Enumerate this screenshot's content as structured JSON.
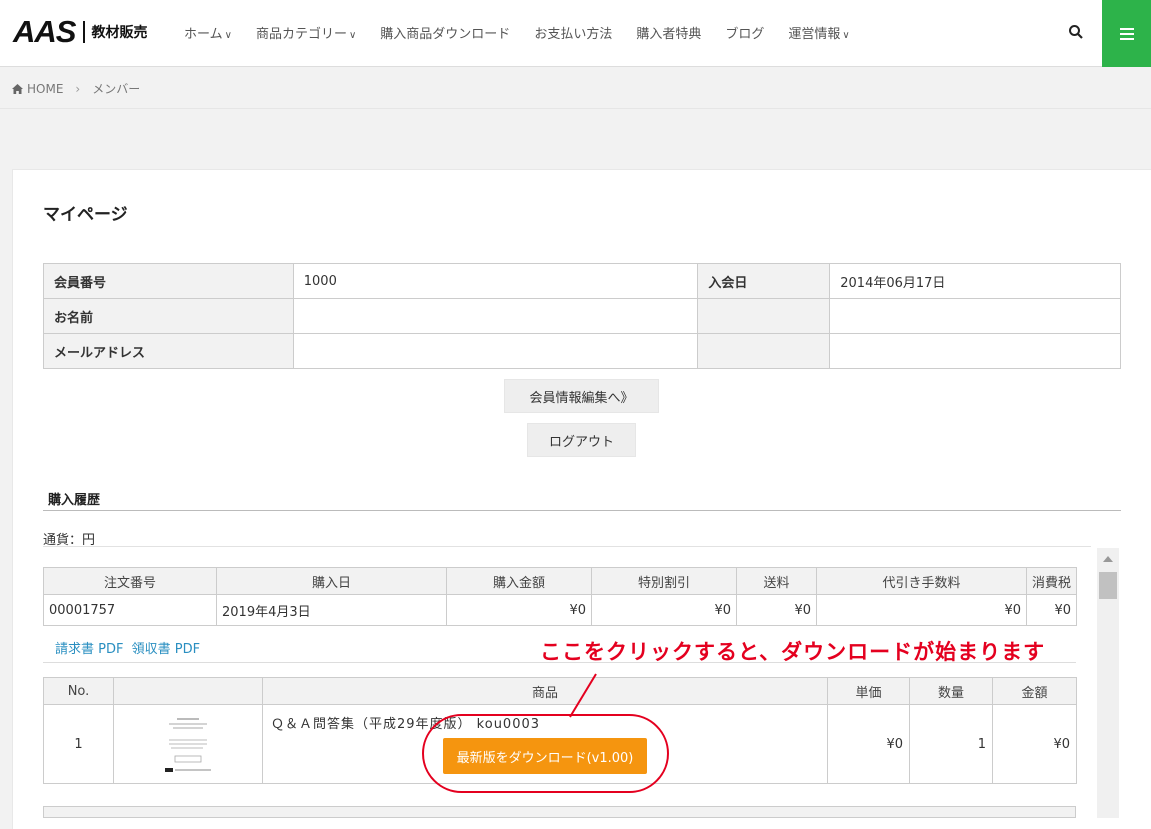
{
  "header": {
    "logo_main": "AAS",
    "logo_sub": "教材販売",
    "nav": [
      {
        "label": "ホーム",
        "chevron": true
      },
      {
        "label": "商品カテゴリー",
        "chevron": true
      },
      {
        "label": "購入商品ダウンロード",
        "chevron": false
      },
      {
        "label": "お支払い方法",
        "chevron": false
      },
      {
        "label": "購入者特典",
        "chevron": false
      },
      {
        "label": "ブログ",
        "chevron": false
      },
      {
        "label": "運営情報",
        "chevron": true
      }
    ],
    "search_icon": "search-icon",
    "menu_icon": "hamburger-icon",
    "menu_color": "#2db34a"
  },
  "breadcrumb": {
    "home": "HOME",
    "current": "メンバー"
  },
  "page": {
    "title": "マイページ"
  },
  "member": {
    "rows": [
      {
        "label": "会員番号",
        "value": "1000",
        "label2": "入会日",
        "value2": "2014年06月17日"
      },
      {
        "label": "お名前",
        "value": "",
        "label2": "",
        "value2": ""
      },
      {
        "label": "メールアドレス",
        "value": "",
        "label2": "",
        "value2": ""
      }
    ],
    "edit_button": "会員情報編集へ》",
    "logout_button": "ログアウト"
  },
  "history": {
    "title": "購入履歴",
    "currency": "通貨：円",
    "order_headers": [
      "注文番号",
      "購入日",
      "購入金額",
      "特別割引",
      "送料",
      "代引き手数料",
      "消費税"
    ],
    "order_row": [
      "00001757",
      "2019年4月3日",
      "¥0",
      "¥0",
      "¥0",
      "¥0",
      "¥0"
    ],
    "invoice_link": "請求書 PDF",
    "receipt_link": "領収書 PDF",
    "product_headers": [
      "No.",
      "",
      "商品",
      "単価",
      "数量",
      "金額"
    ],
    "product": {
      "no": "1",
      "name": "Ｑ＆Ａ問答集（平成29年度版） kou0003",
      "download_button": "最新版をダウンロード(v1.00)",
      "unit_price": "¥0",
      "quantity": "1",
      "amount": "¥0"
    }
  },
  "annotation": {
    "text": "ここをクリックすると、ダウンロードが始まります",
    "color": "#e4001f"
  }
}
